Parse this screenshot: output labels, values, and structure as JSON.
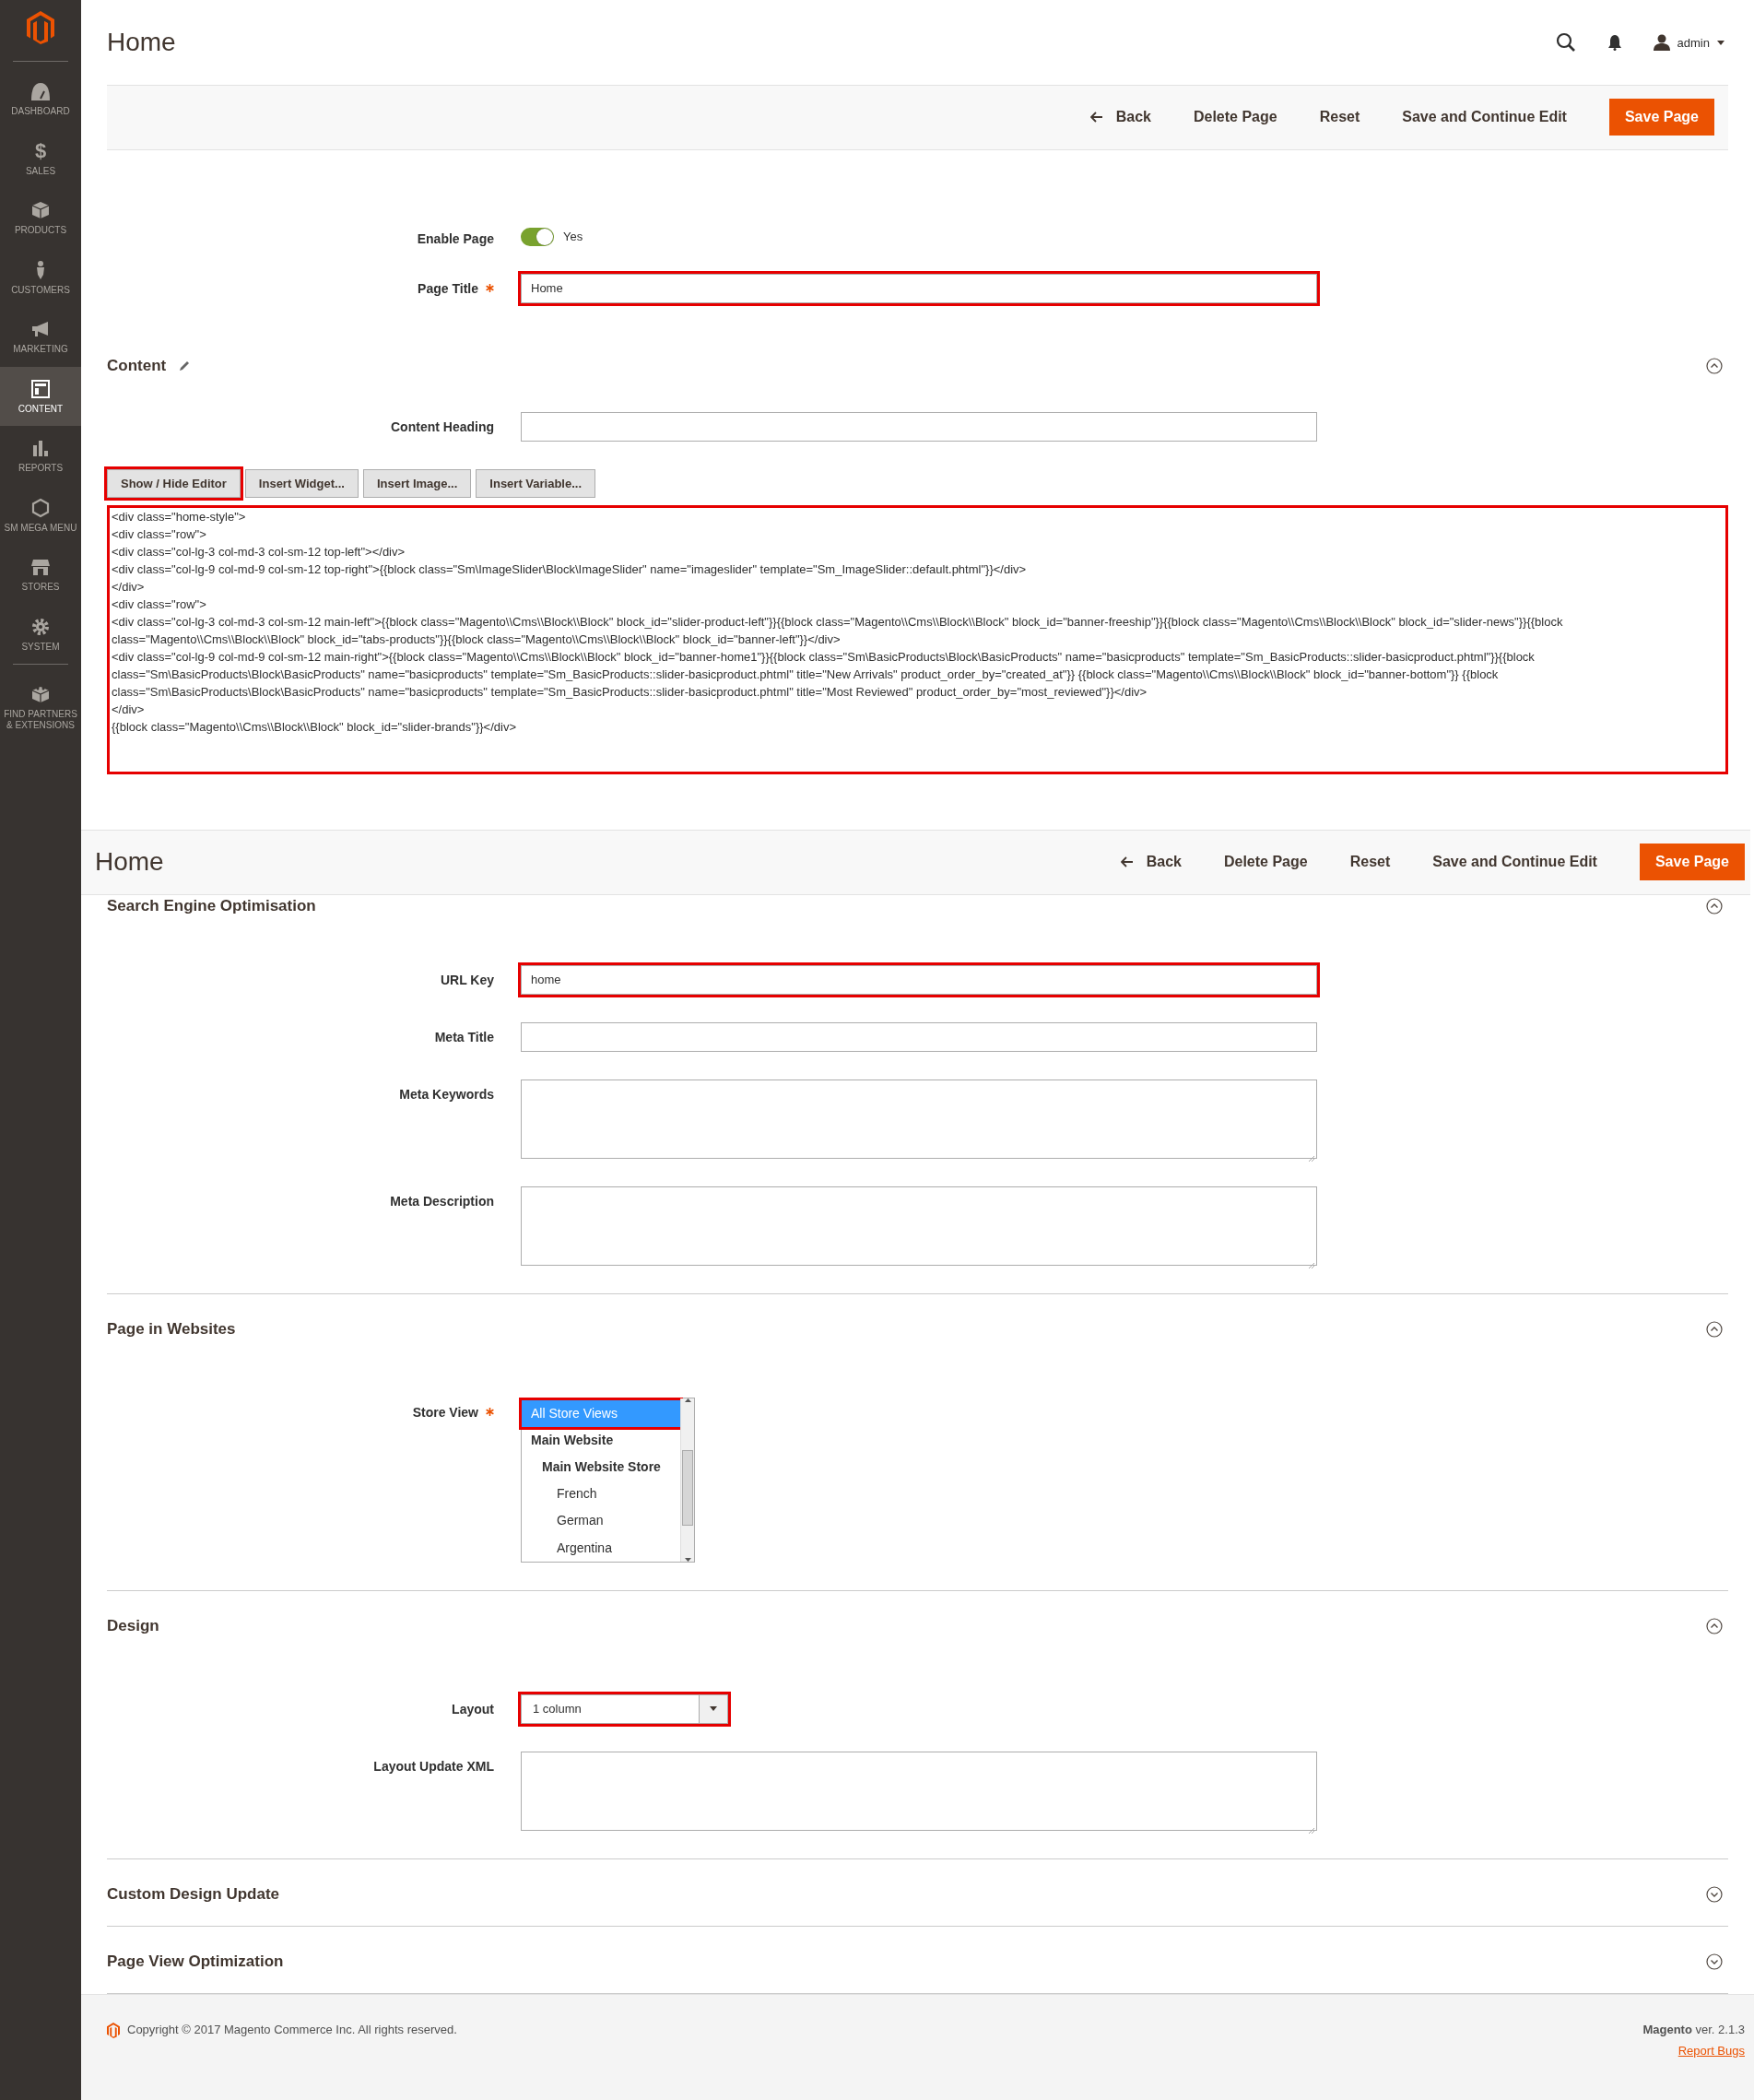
{
  "sidebar": {
    "items": [
      {
        "label": "DASHBOARD",
        "selected": false
      },
      {
        "label": "SALES",
        "selected": false,
        "glyph": "$"
      },
      {
        "label": "PRODUCTS",
        "selected": false
      },
      {
        "label": "CUSTOMERS",
        "selected": false
      },
      {
        "label": "MARKETING",
        "selected": false
      },
      {
        "label": "CONTENT",
        "selected": true
      },
      {
        "label": "REPORTS",
        "selected": false
      },
      {
        "label": "SM MEGA MENU",
        "selected": false
      },
      {
        "label": "STORES",
        "selected": false
      },
      {
        "label": "SYSTEM",
        "selected": false
      },
      {
        "label": "FIND PARTNERS & EXTENSIONS",
        "selected": false
      }
    ]
  },
  "header": {
    "title": "Home",
    "user": "admin"
  },
  "actions": [
    {
      "label": "Back",
      "kind": "back"
    },
    {
      "label": "Delete Page",
      "kind": "plain"
    },
    {
      "label": "Reset",
      "kind": "plain"
    },
    {
      "label": "Save and Continue Edit",
      "kind": "plain"
    },
    {
      "label": "Save Page",
      "kind": "primary"
    }
  ],
  "general_fields": [
    {
      "kind": "toggle",
      "label": "Enable Page",
      "on": true,
      "value": "Yes"
    },
    {
      "kind": "text",
      "label": "Page Title",
      "required": true,
      "value": "Home",
      "highlighted": true
    }
  ],
  "content_section": {
    "title": "Content",
    "expanded": true,
    "fields": [
      {
        "kind": "text",
        "label": "Content Heading"
      }
    ],
    "editor_buttons": [
      {
        "label": "Show / Hide Editor",
        "highlighted": true
      },
      {
        "label": "Insert Widget...",
        "highlighted": false
      },
      {
        "label": "Insert Image...",
        "highlighted": false
      },
      {
        "label": "Insert Variable...",
        "highlighted": false
      }
    ],
    "editor": {
      "highlighted": true,
      "lines": [
        "<div class=\"home-style\">",
        "<div class=\"row\">",
        "<div class=\"col-lg-3 col-md-3 col-sm-12 top-left\"></div>",
        "<div class=\"col-lg-9 col-md-9 col-sm-12 top-right\">{{block class=\"Sm\\ImageSlider\\Block\\ImageSlider\" name=\"imageslider\" template=\"Sm_ImageSlider::default.phtml\"}}</div>",
        "</div>",
        "<div class=\"row\">",
        "<div class=\"col-lg-3 col-md-3 col-sm-12 main-left\">{{block class=\"Magento\\\\Cms\\\\Block\\\\Block\" block_id=\"slider-product-left\"}}{{block class=\"Magento\\\\Cms\\\\Block\\\\Block\" block_id=\"banner-freeship\"}}{{block class=\"Magento\\\\Cms\\\\Block\\\\Block\" block_id=\"slider-news\"}}{{block class=\"Magento\\\\Cms\\\\Block\\\\Block\" block_id=\"tabs-products\"}}{{block class=\"Magento\\\\Cms\\\\Block\\\\Block\" block_id=\"banner-left\"}}</div>",
        "<div class=\"col-lg-9 col-md-9 col-sm-12 main-right\">{{block class=\"Magento\\\\Cms\\\\Block\\\\Block\" block_id=\"banner-home1\"}}{{block class=\"Sm\\BasicProducts\\Block\\BasicProducts\" name=\"basicproducts\" template=\"Sm_BasicProducts::slider-basicproduct.phtml\"}}{{block class=\"Sm\\BasicProducts\\Block\\BasicProducts\" name=\"basicproducts\" template=\"Sm_BasicProducts::slider-basicproduct.phtml\" title=\"New Arrivals\" product_order_by=\"created_at\"}} {{block class=\"Magento\\\\Cms\\\\Block\\\\Block\" block_id=\"banner-bottom\"}} {{block class=\"Sm\\BasicProducts\\Block\\BasicProducts\" name=\"basicproducts\" template=\"Sm_BasicProducts::slider-basicproduct.phtml\" title=\"Most Reviewed\" product_order_by=\"most_reviewed\"}}</div>",
        "</div>",
        "{{block class=\"Magento\\\\Cms\\\\Block\\\\Block\" block_id=\"slider-brands\"}}</div>"
      ]
    }
  },
  "sticky_header": {
    "title": "Home",
    "actions": [
      {
        "label": "Back",
        "kind": "back"
      },
      {
        "label": "Delete Page",
        "kind": "plain"
      },
      {
        "label": "Reset",
        "kind": "plain"
      },
      {
        "label": "Save and Continue Edit",
        "kind": "plain"
      },
      {
        "label": "Save Page",
        "kind": "primary"
      }
    ]
  },
  "sections": [
    {
      "title": "Search Engine Optimisation",
      "expanded": true,
      "fields": [
        {
          "kind": "text",
          "label": "URL Key",
          "value": "home",
          "highlighted": true
        },
        {
          "kind": "text",
          "label": "Meta Title"
        },
        {
          "kind": "textarea",
          "label": "Meta Keywords"
        },
        {
          "kind": "textarea",
          "label": "Meta Description"
        }
      ]
    },
    {
      "title": "Page in Websites",
      "expanded": true,
      "fields": [
        {
          "kind": "listbox",
          "label": "Store View",
          "required": true,
          "options": [
            {
              "label": "All Store Views",
              "selected": true,
              "highlighted": true
            },
            {
              "label": "Main Website",
              "selected": false,
              "children": [
                {
                  "label": "Main Website Store",
                  "selected": false,
                  "children": [
                    {
                      "label": "French",
                      "selected": false
                    },
                    {
                      "label": "German",
                      "selected": false
                    },
                    {
                      "label": "Argentina",
                      "selected": false
                    }
                  ]
                }
              ]
            }
          ]
        }
      ]
    },
    {
      "title": "Design",
      "expanded": true,
      "fields": [
        {
          "kind": "select",
          "label": "Layout",
          "value": "1 column",
          "highlighted": true
        },
        {
          "kind": "textarea",
          "label": "Layout Update XML"
        }
      ]
    },
    {
      "title": "Custom Design Update",
      "expanded": false
    },
    {
      "title": "Page View Optimization",
      "expanded": false
    }
  ],
  "footer": {
    "copyright": "Copyright © 2017 Magento Commerce Inc. All rights reserved.",
    "version": "**Magento** ver. 2.1.3",
    "link": "Report Bugs"
  }
}
